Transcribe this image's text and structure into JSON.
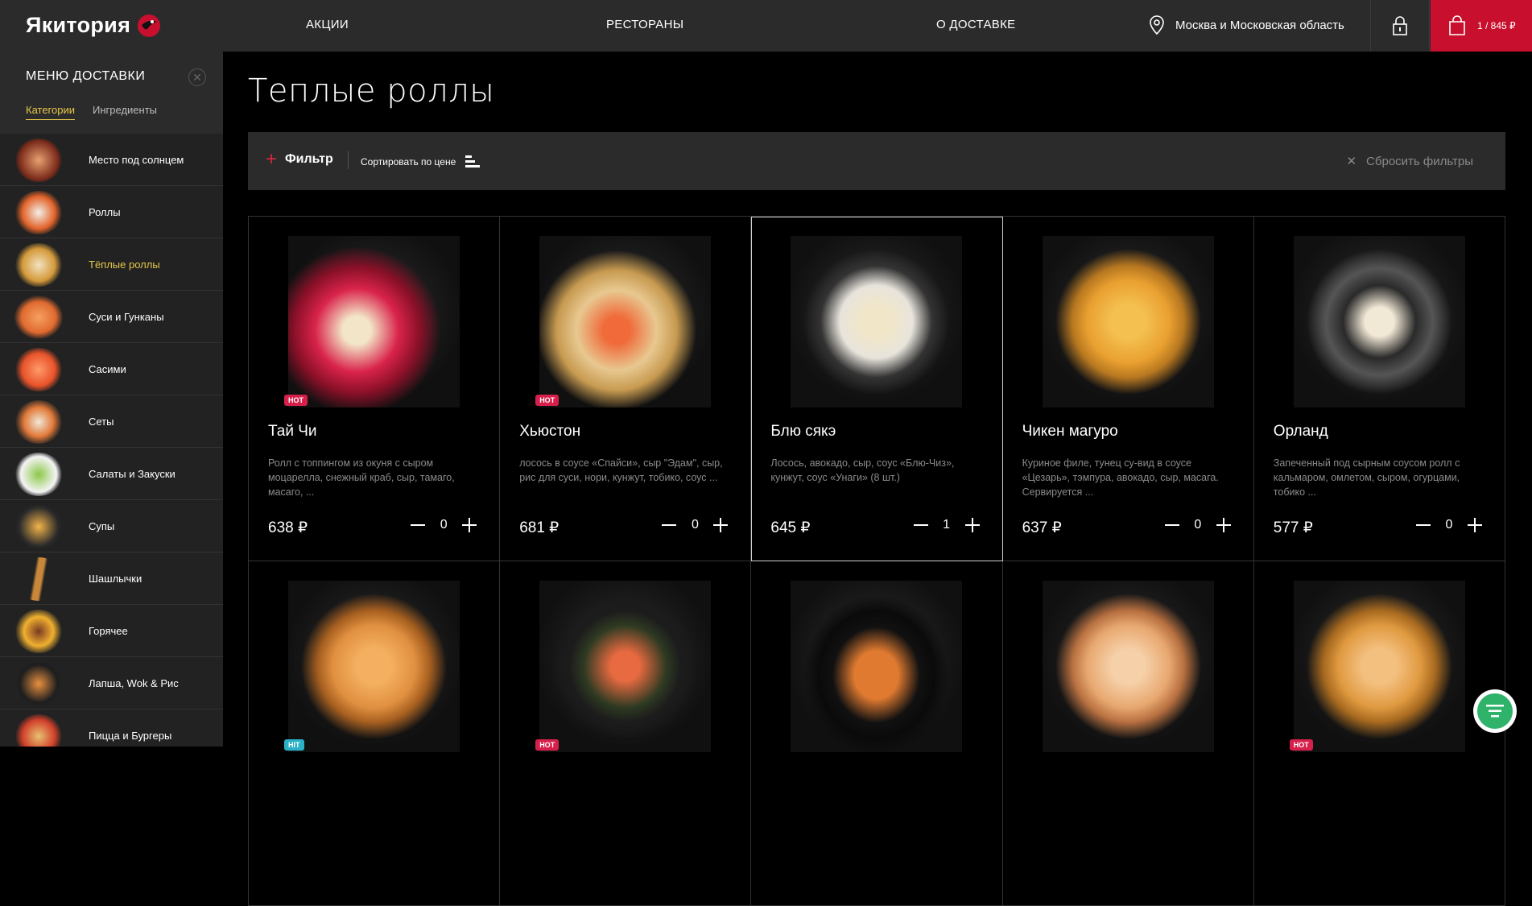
{
  "header": {
    "logo_text": "Якитория",
    "nav": [
      "АКЦИИ",
      "РЕСТОРАНЫ",
      "О ДОСТАВКЕ"
    ],
    "location": "Москва и Московская область",
    "cart": "1 / 845 ₽",
    "brand_color": "#c8102e"
  },
  "sidebar": {
    "title": "МЕНЮ ДОСТАВКИ",
    "tabs": [
      {
        "label": "Категории",
        "active": true
      },
      {
        "label": "Ингредиенты",
        "active": false
      }
    ],
    "categories": [
      {
        "label": "Место под солнцем"
      },
      {
        "label": "Роллы"
      },
      {
        "label": "Тёплые роллы",
        "active": true
      },
      {
        "label": "Суси и Гунканы"
      },
      {
        "label": "Сасими"
      },
      {
        "label": "Сеты"
      },
      {
        "label": "Салаты и Закуски"
      },
      {
        "label": "Супы"
      },
      {
        "label": "Шашлычки"
      },
      {
        "label": "Горячее"
      },
      {
        "label": "Лапша, Wok & Рис"
      },
      {
        "label": "Пицца и Бургеры"
      }
    ]
  },
  "main": {
    "title": "Теплые роллы",
    "filter_label": "Фильтр",
    "sort_label": "Сортировать по цене",
    "reset_label": "Сбросить фильтры"
  },
  "products": [
    {
      "name": "Тай Чи",
      "desc": "Ролл с топпингом из окуня с сыром моцарелла, снежный краб, сыр, тамаго, масаго, ...",
      "price": "638 ₽",
      "qty": "0",
      "badge": "HOT"
    },
    {
      "name": "Хьюстон",
      "desc": "лосось в соусе «Спайси», сыр \"Эдам\", сыр, рис для суси, нори, кунжут, тобико, соус ...",
      "price": "681 ₽",
      "qty": "0",
      "badge": "HOT"
    },
    {
      "name": "Блю сякэ",
      "desc": "Лосось, авокадо, сыр, соус «Блю-Чиз», кунжут, соус «Унаги» (8 шт.)",
      "price": "645 ₽",
      "qty": "1",
      "badge": ""
    },
    {
      "name": "Чикен магуро",
      "desc": "Куриное филе, тунец су-вид в соусе «Цезарь», тэмпура, авокадо, сыр, масага. Сервируется ...",
      "price": "637 ₽",
      "qty": "0",
      "badge": ""
    },
    {
      "name": "Орланд",
      "desc": "Запеченный под сырным соусом ролл с кальмаром, омлетом, сыром, огурцами, тобико ...",
      "price": "577 ₽",
      "qty": "0",
      "badge": ""
    },
    {
      "name": "",
      "desc": "",
      "price": "",
      "qty": "",
      "badge": "HIT"
    },
    {
      "name": "",
      "desc": "",
      "price": "",
      "qty": "",
      "badge": "HOT"
    },
    {
      "name": "",
      "desc": "",
      "price": "",
      "qty": "",
      "badge": ""
    },
    {
      "name": "",
      "desc": "",
      "price": "",
      "qty": "",
      "badge": ""
    },
    {
      "name": "",
      "desc": "",
      "price": "",
      "qty": "",
      "badge": "HOT"
    }
  ]
}
